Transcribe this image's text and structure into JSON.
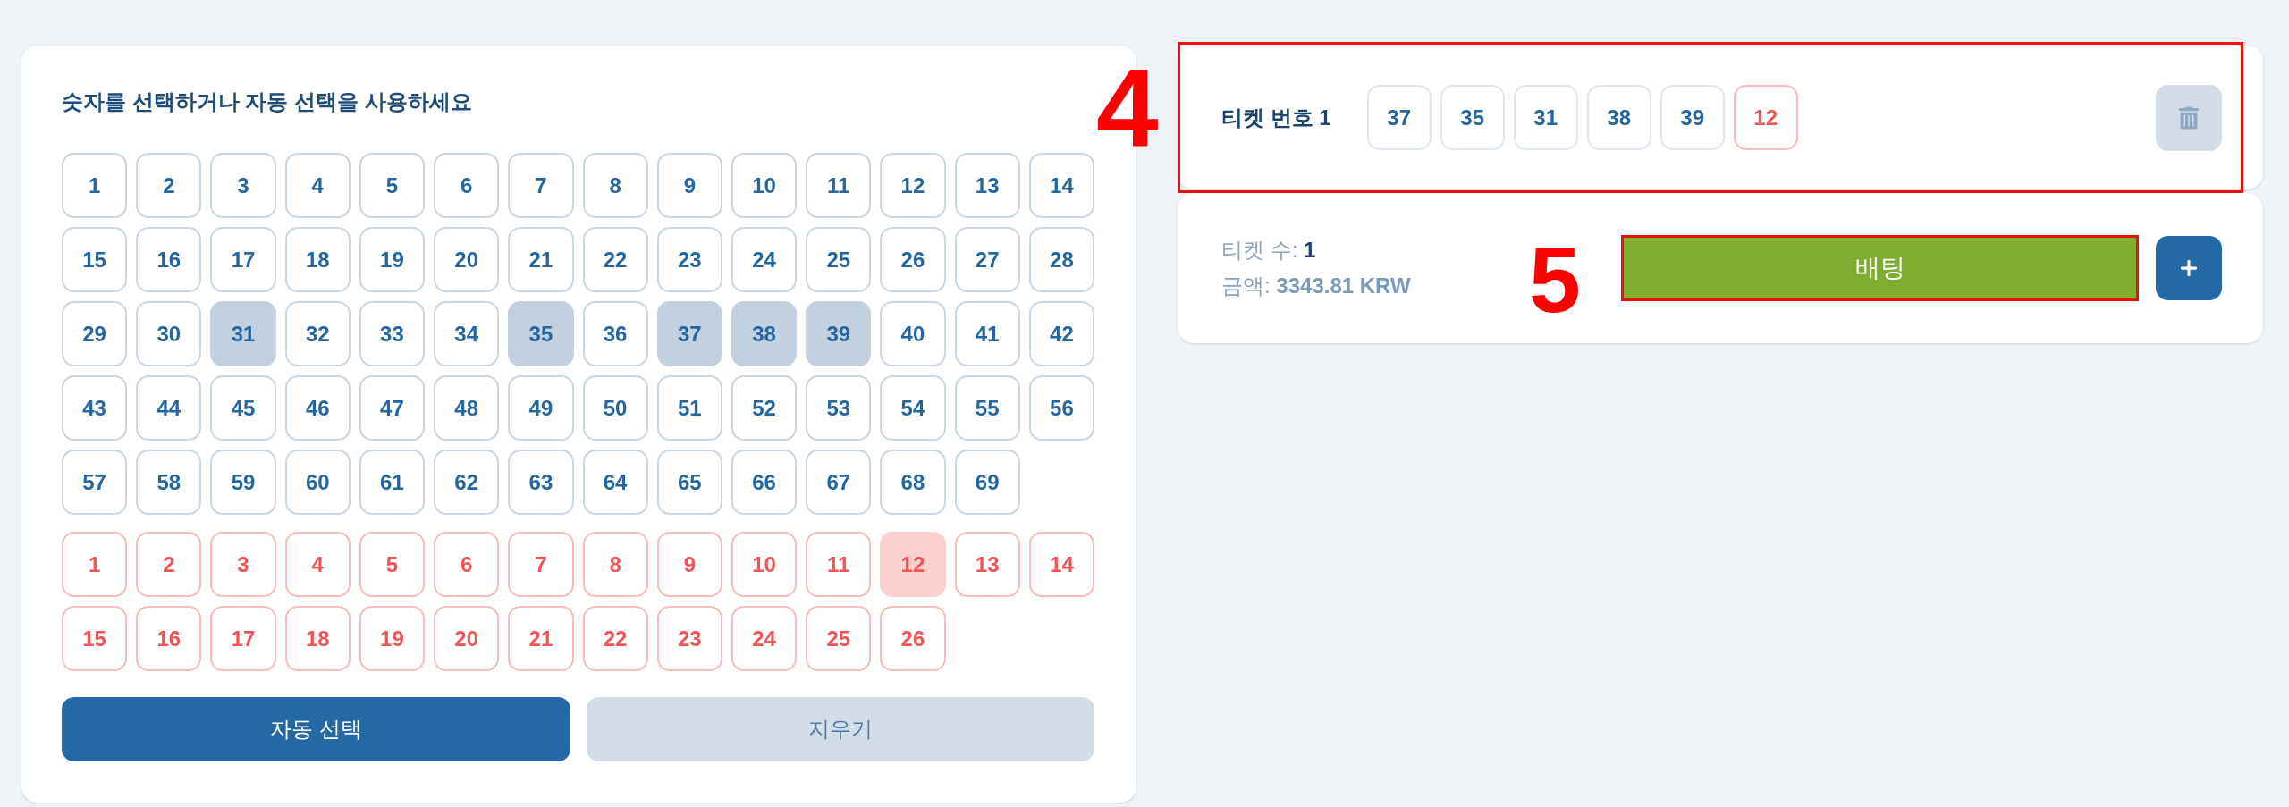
{
  "picker": {
    "title": "숫자를 선택하거나 자동 선택을 사용하세요",
    "main_numbers": [
      {
        "label": "1",
        "selected": false
      },
      {
        "label": "2",
        "selected": false
      },
      {
        "label": "3",
        "selected": false
      },
      {
        "label": "4",
        "selected": false
      },
      {
        "label": "5",
        "selected": false
      },
      {
        "label": "6",
        "selected": false
      },
      {
        "label": "7",
        "selected": false
      },
      {
        "label": "8",
        "selected": false
      },
      {
        "label": "9",
        "selected": false
      },
      {
        "label": "10",
        "selected": false
      },
      {
        "label": "11",
        "selected": false
      },
      {
        "label": "12",
        "selected": false
      },
      {
        "label": "13",
        "selected": false
      },
      {
        "label": "14",
        "selected": false
      },
      {
        "label": "15",
        "selected": false
      },
      {
        "label": "16",
        "selected": false
      },
      {
        "label": "17",
        "selected": false
      },
      {
        "label": "18",
        "selected": false
      },
      {
        "label": "19",
        "selected": false
      },
      {
        "label": "20",
        "selected": false
      },
      {
        "label": "21",
        "selected": false
      },
      {
        "label": "22",
        "selected": false
      },
      {
        "label": "23",
        "selected": false
      },
      {
        "label": "24",
        "selected": false
      },
      {
        "label": "25",
        "selected": false
      },
      {
        "label": "26",
        "selected": false
      },
      {
        "label": "27",
        "selected": false
      },
      {
        "label": "28",
        "selected": false
      },
      {
        "label": "29",
        "selected": false
      },
      {
        "label": "30",
        "selected": false
      },
      {
        "label": "31",
        "selected": true
      },
      {
        "label": "32",
        "selected": false
      },
      {
        "label": "33",
        "selected": false
      },
      {
        "label": "34",
        "selected": false
      },
      {
        "label": "35",
        "selected": true
      },
      {
        "label": "36",
        "selected": false
      },
      {
        "label": "37",
        "selected": true
      },
      {
        "label": "38",
        "selected": true
      },
      {
        "label": "39",
        "selected": true
      },
      {
        "label": "40",
        "selected": false
      },
      {
        "label": "41",
        "selected": false
      },
      {
        "label": "42",
        "selected": false
      },
      {
        "label": "43",
        "selected": false
      },
      {
        "label": "44",
        "selected": false
      },
      {
        "label": "45",
        "selected": false
      },
      {
        "label": "46",
        "selected": false
      },
      {
        "label": "47",
        "selected": false
      },
      {
        "label": "48",
        "selected": false
      },
      {
        "label": "49",
        "selected": false
      },
      {
        "label": "50",
        "selected": false
      },
      {
        "label": "51",
        "selected": false
      },
      {
        "label": "52",
        "selected": false
      },
      {
        "label": "53",
        "selected": false
      },
      {
        "label": "54",
        "selected": false
      },
      {
        "label": "55",
        "selected": false
      },
      {
        "label": "56",
        "selected": false
      },
      {
        "label": "57",
        "selected": false
      },
      {
        "label": "58",
        "selected": false
      },
      {
        "label": "59",
        "selected": false
      },
      {
        "label": "60",
        "selected": false
      },
      {
        "label": "61",
        "selected": false
      },
      {
        "label": "62",
        "selected": false
      },
      {
        "label": "63",
        "selected": false
      },
      {
        "label": "64",
        "selected": false
      },
      {
        "label": "65",
        "selected": false
      },
      {
        "label": "66",
        "selected": false
      },
      {
        "label": "67",
        "selected": false
      },
      {
        "label": "68",
        "selected": false
      },
      {
        "label": "69",
        "selected": false
      }
    ],
    "bonus_numbers": [
      {
        "label": "1",
        "selected": false
      },
      {
        "label": "2",
        "selected": false
      },
      {
        "label": "3",
        "selected": false
      },
      {
        "label": "4",
        "selected": false
      },
      {
        "label": "5",
        "selected": false
      },
      {
        "label": "6",
        "selected": false
      },
      {
        "label": "7",
        "selected": false
      },
      {
        "label": "8",
        "selected": false
      },
      {
        "label": "9",
        "selected": false
      },
      {
        "label": "10",
        "selected": false
      },
      {
        "label": "11",
        "selected": false
      },
      {
        "label": "12",
        "selected": true
      },
      {
        "label": "13",
        "selected": false
      },
      {
        "label": "14",
        "selected": false
      },
      {
        "label": "15",
        "selected": false
      },
      {
        "label": "16",
        "selected": false
      },
      {
        "label": "17",
        "selected": false
      },
      {
        "label": "18",
        "selected": false
      },
      {
        "label": "19",
        "selected": false
      },
      {
        "label": "20",
        "selected": false
      },
      {
        "label": "21",
        "selected": false
      },
      {
        "label": "22",
        "selected": false
      },
      {
        "label": "23",
        "selected": false
      },
      {
        "label": "24",
        "selected": false
      },
      {
        "label": "25",
        "selected": false
      },
      {
        "label": "26",
        "selected": false
      }
    ],
    "buttons": [
      {
        "label": "자동 선택",
        "kind": "primary"
      },
      {
        "label": "지우기",
        "kind": "secondary"
      }
    ]
  },
  "ticket": {
    "title": "티켓 번호 1",
    "numbers": [
      {
        "label": "37",
        "kind": "main"
      },
      {
        "label": "35",
        "kind": "main"
      },
      {
        "label": "31",
        "kind": "main"
      },
      {
        "label": "38",
        "kind": "main"
      },
      {
        "label": "39",
        "kind": "main"
      },
      {
        "label": "12",
        "kind": "bonus"
      }
    ]
  },
  "summary": {
    "count_label": "티켓 수:",
    "count": "1",
    "amount_label": "금액:",
    "amount": "3343.81 KRW",
    "bet_button": "배팅"
  },
  "annotations": [
    {
      "label": "4"
    },
    {
      "label": "5"
    }
  ]
}
